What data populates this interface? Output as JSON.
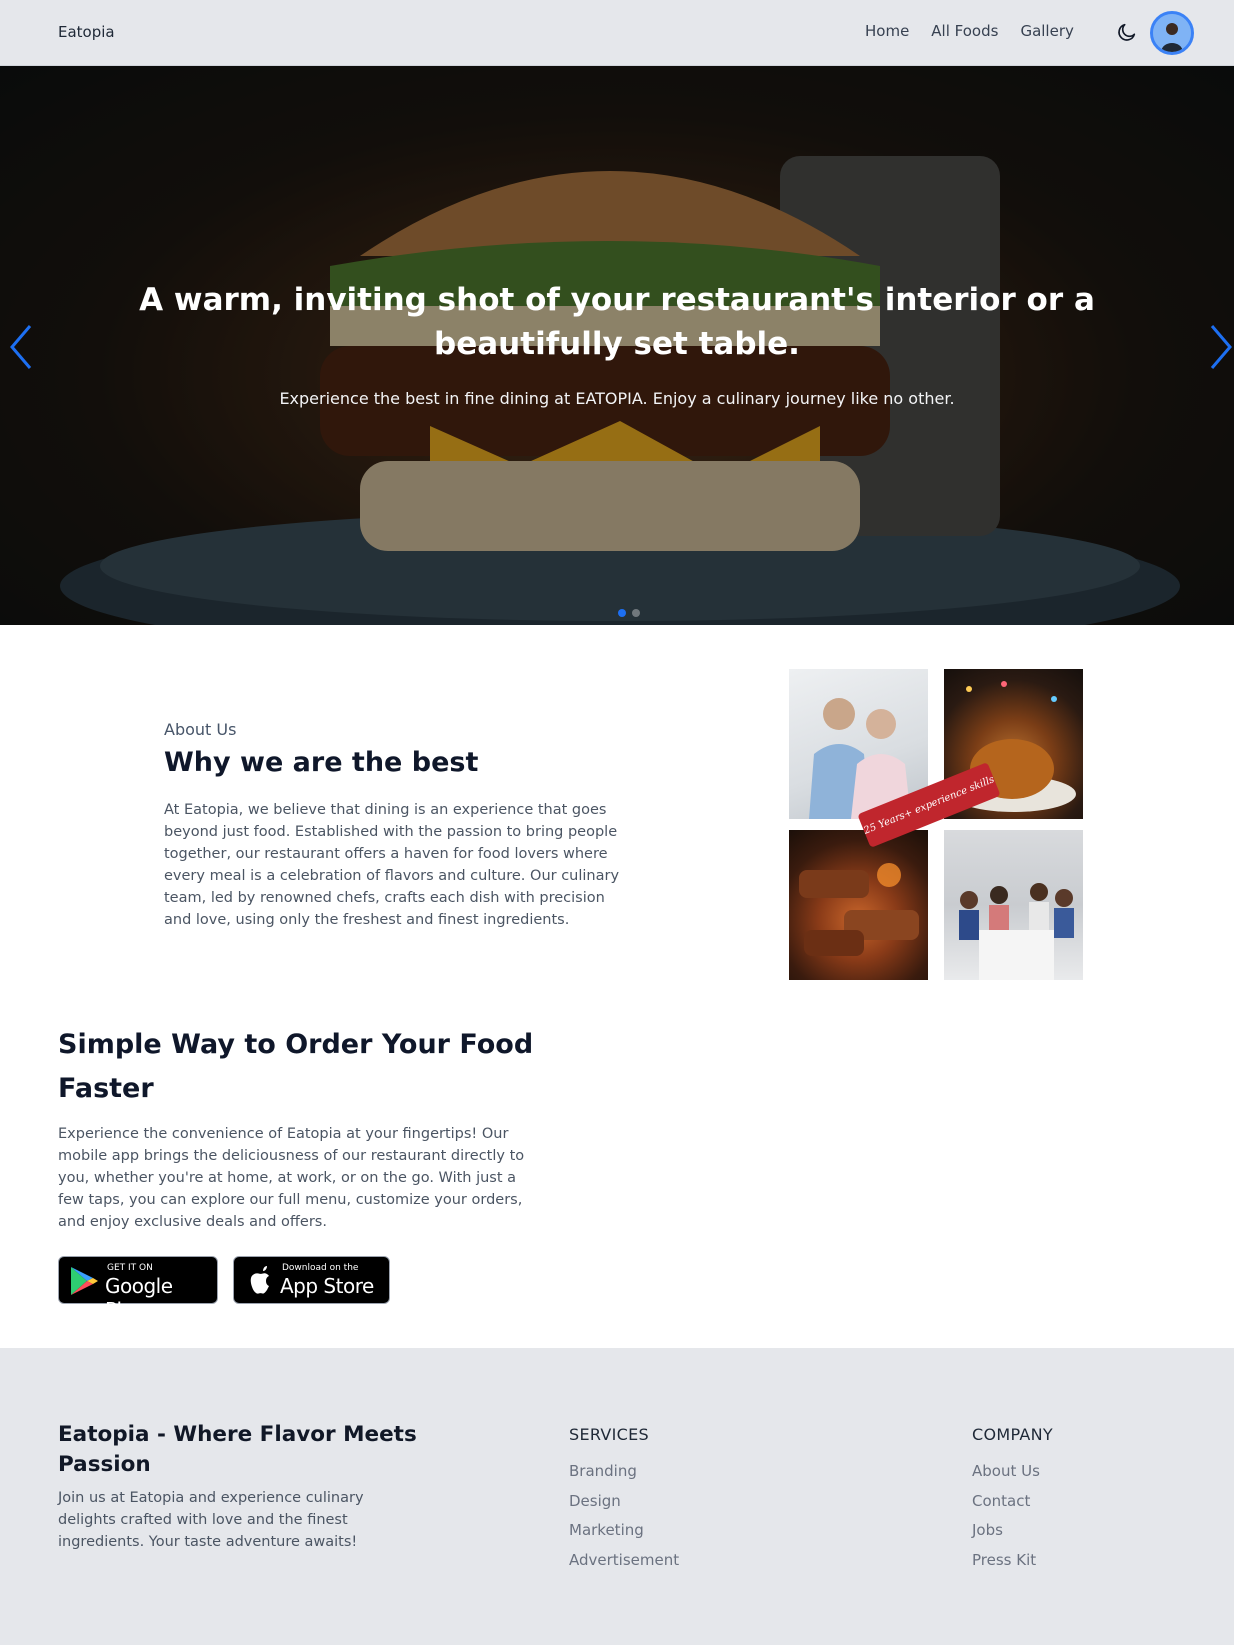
{
  "navbar": {
    "brand": "Eatopia",
    "links": [
      "Home",
      "All Foods",
      "Gallery"
    ],
    "theme_icon": "moon-icon",
    "avatar_icon": "user-avatar"
  },
  "hero": {
    "title": "A warm, inviting shot of your restaurant's interior or a beautifully set table.",
    "subtitle": "Experience the best in fine dining at EATOPIA. Enjoy a culinary journey like no other.",
    "prev_icon": "chevron-left-icon",
    "next_icon": "chevron-right-icon",
    "active_slide": 1,
    "slide_count": 2
  },
  "about": {
    "eyebrow": "About Us",
    "title": "Why we are the best",
    "text": "At Eatopia, we believe that dining is an experience that goes beyond just food. Established with the passion to bring people together, our restaurant offers a haven for food lovers where every meal is a celebration of flavors and culture. Our culinary team, led by renowned chefs, crafts each dish with precision and love, using only the freshest and finest ingredients.",
    "badge": "25 Years+ experience skills"
  },
  "app": {
    "title": "Simple Way to Order Your Food Faster",
    "text": "Experience the convenience of Eatopia at your fingertips! Our mobile app brings the deliciousness of our restaurant directly to you, whether you're at home, at work, or on the go. With just a few taps, you can explore our full menu, customize your orders, and enjoy exclusive deals and offers.",
    "google_play": {
      "small": "GET IT ON",
      "big": "Google Play"
    },
    "app_store": {
      "small": "Download on the",
      "big": "App Store"
    }
  },
  "footer": {
    "title": "Eatopia - Where Flavor Meets Passion",
    "text": "Join us at Eatopia and experience culinary delights crafted with love and the finest ingredients. Your taste adventure awaits!",
    "services": {
      "heading": "SERVICES",
      "links": [
        "Branding",
        "Design",
        "Marketing",
        "Advertisement"
      ]
    },
    "company": {
      "heading": "COMPANY",
      "links": [
        "About Us",
        "Contact",
        "Jobs",
        "Press Kit"
      ]
    }
  },
  "colors": {
    "accent": "#1d6ff2",
    "navbar_bg": "#e5e7eb",
    "footer_bg": "#e5e7eb",
    "badge_red": "#c0262d"
  }
}
